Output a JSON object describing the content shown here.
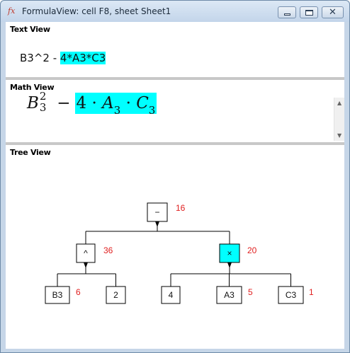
{
  "window": {
    "icon": "fx",
    "title": "FormulaView: cell F8, sheet Sheet1"
  },
  "panels": {
    "text_title": "Text View",
    "math_title": "Math View",
    "tree_title": "Tree View"
  },
  "text_view": {
    "plain": "B3^2 - ",
    "highlighted": "4*A3*C3"
  },
  "math_view": {
    "b": "B",
    "b_sub": "3",
    "b_sup": "2",
    "minus": "−",
    "four": "4",
    "dot": "·",
    "a": "A",
    "a_sub": "3",
    "c": "C",
    "c_sub": "3"
  },
  "tree": {
    "nodes": [
      {
        "id": "minus",
        "label": "−",
        "num": "16",
        "highlight": false
      },
      {
        "id": "caret",
        "label": "^",
        "num": "36",
        "highlight": false
      },
      {
        "id": "times",
        "label": "×",
        "num": "20",
        "highlight": true
      },
      {
        "id": "b3",
        "label": "B3",
        "num": "6",
        "highlight": false
      },
      {
        "id": "two",
        "label": "2",
        "num": "",
        "highlight": false
      },
      {
        "id": "four",
        "label": "4",
        "num": "",
        "highlight": false
      },
      {
        "id": "a3",
        "label": "A3",
        "num": "5",
        "highlight": false
      },
      {
        "id": "c3",
        "label": "C3",
        "num": "1",
        "highlight": false
      }
    ]
  },
  "colors": {
    "highlight": "#00ffff",
    "count_text": "#e02020"
  }
}
